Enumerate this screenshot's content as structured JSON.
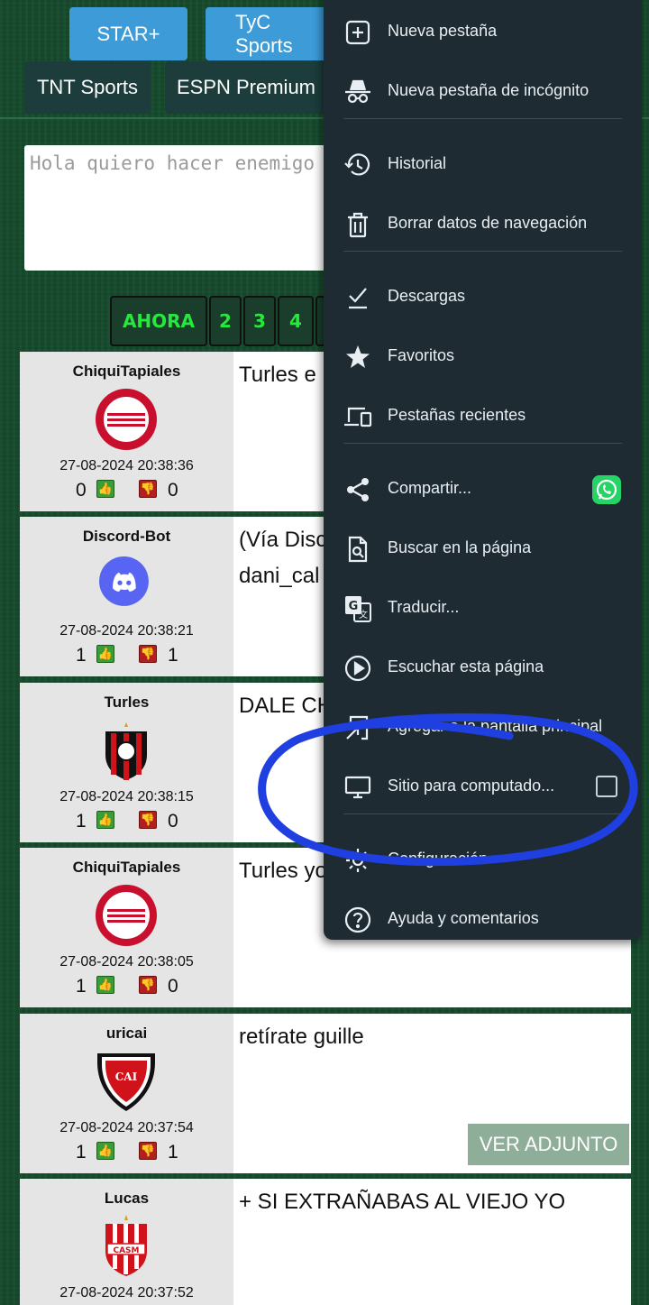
{
  "channels": {
    "star_plus": "STAR+",
    "tyc_sports": "TyC Sports",
    "tnt_sports": "TNT Sports",
    "espn_premium": "ESPN Premium"
  },
  "message_box": {
    "placeholder": "Hola quiero hacer enemigo"
  },
  "pagination": [
    "AHORA",
    "2",
    "3",
    "4"
  ],
  "posts": [
    {
      "user": "ChiquiTapiales",
      "date": "27-08-2024 20:38:36",
      "up": "0",
      "down": "0",
      "text": "Turles e",
      "avatar": "barracas-central-crest"
    },
    {
      "user": "Discord-Bot",
      "date": "27-08-2024 20:38:21",
      "up": "1",
      "down": "1",
      "text": "(Vía Disc",
      "text2": "dani_cal",
      "avatar": "discord-logo"
    },
    {
      "user": "Turles",
      "date": "27-08-2024 20:38:15",
      "up": "1",
      "down": "0",
      "text": "DALE CH",
      "avatar": "chacarita-crest"
    },
    {
      "user": "ChiquiTapiales",
      "date": "27-08-2024 20:38:05",
      "up": "1",
      "down": "0",
      "text": "Turles yo",
      "avatar": "barracas-central-crest"
    },
    {
      "user": "uricai",
      "date": "27-08-2024 20:37:54",
      "up": "1",
      "down": "1",
      "text": "retírate guille",
      "avatar": "independiente-crest",
      "attachment": "VER ADJUNTO"
    },
    {
      "user": "Lucas",
      "date": "27-08-2024 20:37:52",
      "text": "+ SI EXTRAÑABAS AL VIEJO YO",
      "avatar": "san-martin-crest"
    }
  ],
  "menu": {
    "new_tab": "Nueva pestaña",
    "incognito": "Nueva pestaña de incógnito",
    "history": "Historial",
    "clear_data": "Borrar datos de navegación",
    "downloads": "Descargas",
    "favorites": "Favoritos",
    "recent_tabs": "Pestañas recientes",
    "share": "Compartir...",
    "find": "Buscar en la página",
    "translate": "Traducir...",
    "listen": "Escuchar esta página",
    "add_home": "Agregar a la pantalla principal",
    "desktop_site": "Sitio para computado...",
    "settings": "Configuración",
    "help": "Ayuda y comentarios"
  },
  "colors": {
    "menu_bg": "#1e2b33",
    "annotation": "#1f3fe0",
    "page_bg": "#164a2c",
    "pager_text": "#27e83c"
  }
}
